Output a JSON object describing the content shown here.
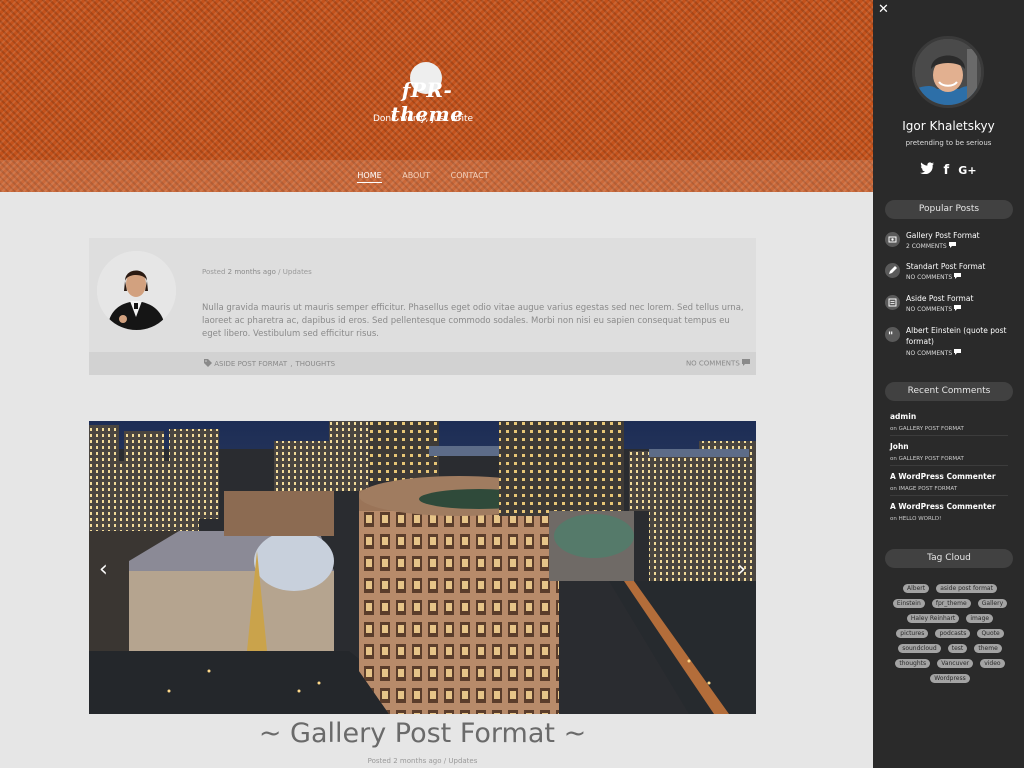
{
  "site": {
    "logo_text": "fPR-theme",
    "tagline": "Don't worry, just write",
    "nav": [
      "HOME",
      "ABOUT",
      "CONTACT"
    ]
  },
  "aside_post": {
    "posted_prefix": "Posted",
    "posted_when": "2 months ago",
    "posted_sep": "/",
    "category": "Updates",
    "text": "Nulla gravida mauris ut mauris semper efficitur. Phasellus eget odio vitae augue varius egestas sed nec lorem. Sed tellus urna, laoreet ac pharetra ac, dapibus id eros. Sed pellentesque commodo sodales. Morbi non nisi eu sapien consequat tempus eu eget libero. Vestibulum sed efficitur risus.",
    "tags": [
      "ASIDE POST FORMAT",
      "THOUGHTS"
    ],
    "tag_sep": ",",
    "comments": "NO COMMENTS"
  },
  "gallery_post": {
    "title": "~ Gallery Post Format ~",
    "posted_prefix": "Posted",
    "posted_when": "2 months ago",
    "posted_sep": "/",
    "category": "Updates",
    "prev_arrow": "‹",
    "next_arrow": "›"
  },
  "sidebar": {
    "close": "✕",
    "name": "Igor Khaletskyy",
    "subtitle": "pretending to be serious",
    "social_icons": [
      "twitter-icon",
      "facebook-icon",
      "google-plus-icon"
    ],
    "social_labels": {
      "facebook": "f",
      "google_plus": "G+"
    },
    "popular_title": "Popular Posts",
    "popular": [
      {
        "title": "Gallery Post Format",
        "count": "2 COMMENTS",
        "icon": "gallery-icon"
      },
      {
        "title": "Standart Post Format",
        "count": "NO COMMENTS",
        "icon": "pencil-icon"
      },
      {
        "title": "Aside Post Format",
        "count": "NO COMMENTS",
        "icon": "note-icon"
      },
      {
        "title": "Albert Einstein (quote post format)",
        "count": "NO COMMENTS",
        "icon": "quote-icon"
      }
    ],
    "recent_title": "Recent Comments",
    "recent": [
      {
        "author": "admin",
        "on": "on GALLERY POST FORMAT"
      },
      {
        "author": "John",
        "on": "on GALLERY POST FORMAT"
      },
      {
        "author": "A WordPress Commenter",
        "on": "on IMAGE POST FORMAT"
      },
      {
        "author": "A WordPress Commenter",
        "on": "on HELLO WORLD!"
      }
    ],
    "tags_title": "Tag Cloud",
    "tags": [
      "Albert",
      "aside post format",
      "Einstein",
      "fpr_theme",
      "Gallery",
      "Haley Reinhart",
      "image",
      "pictures",
      "podcasts",
      "Quote",
      "soundcloud",
      "test",
      "theme",
      "thoughts",
      "Vancuver",
      "video",
      "Wordpress"
    ]
  },
  "colors": {
    "header": "#c4521b",
    "sidebar": "#2a2a2a",
    "page_bg": "#e6e6e6",
    "card_bg": "#dedede"
  }
}
